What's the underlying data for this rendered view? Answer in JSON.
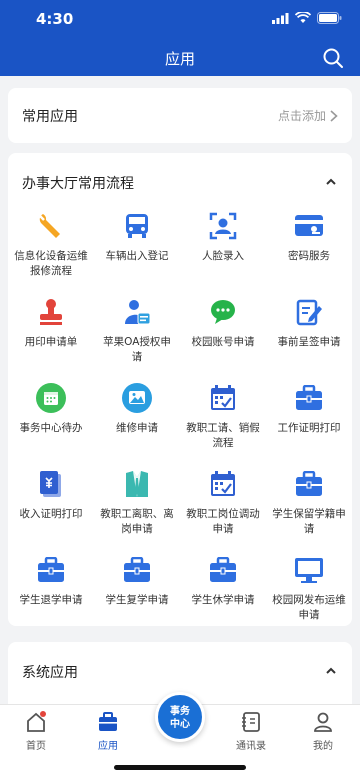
{
  "status": {
    "time": "4:30"
  },
  "header": {
    "title": "应用"
  },
  "common": {
    "label": "常用应用",
    "add_label": "点击添加"
  },
  "hall": {
    "title": "办事大厅常用流程",
    "items": [
      {
        "label": "信息化设备运维报修流程",
        "icon": "wrench-icon",
        "color": "#f5a623"
      },
      {
        "label": "车辆出入登记",
        "icon": "car-icon",
        "color": "#2f6fe0"
      },
      {
        "label": "人脸录入",
        "icon": "face-scan-icon",
        "color": "#2f6fe0"
      },
      {
        "label": "密码服务",
        "icon": "card-icon",
        "color": "#2f6fe0"
      },
      {
        "label": "用印申请单",
        "icon": "stamp-icon",
        "color": "#e2443b"
      },
      {
        "label": "苹果OA授权申请",
        "icon": "user-card-icon",
        "color": "#2f6fe0"
      },
      {
        "label": "校园账号申请",
        "icon": "chat-icon",
        "color": "#26b34a"
      },
      {
        "label": "事前呈签申请",
        "icon": "edit-doc-icon",
        "color": "#2f6fe0"
      },
      {
        "label": "事务中心待办",
        "icon": "calendar-icon",
        "color": "#3cbf5a"
      },
      {
        "label": "维修申请",
        "icon": "image-icon",
        "color": "#2a9ee0"
      },
      {
        "label": "教职工请、销假流程",
        "icon": "calendar-check-icon",
        "color": "#2f5fd0"
      },
      {
        "label": "工作证明打印",
        "icon": "briefcase-icon",
        "color": "#2f6fe0"
      },
      {
        "label": "收入证明打印",
        "icon": "document-icon",
        "color": "#2f5fd0"
      },
      {
        "label": "教职工离职、离岗申请",
        "icon": "shirt-icon",
        "color": "#3bb8b0"
      },
      {
        "label": "教职工岗位调动申请",
        "icon": "calendar-check-icon",
        "color": "#2f5fd0"
      },
      {
        "label": "学生保留学籍申请",
        "icon": "briefcase-icon",
        "color": "#2f6fe0"
      },
      {
        "label": "学生退学申请",
        "icon": "briefcase-icon",
        "color": "#2f6fe0"
      },
      {
        "label": "学生复学申请",
        "icon": "briefcase-icon",
        "color": "#2f6fe0"
      },
      {
        "label": "学生休学申请",
        "icon": "briefcase-icon",
        "color": "#2f6fe0"
      },
      {
        "label": "校园网发布运维申请",
        "icon": "monitor-icon",
        "color": "#2f6fe0"
      }
    ]
  },
  "system": {
    "title": "系统应用"
  },
  "tabs": [
    {
      "label": "首页",
      "icon": "home-icon"
    },
    {
      "label": "应用",
      "icon": "briefcase-icon"
    },
    {
      "label": "通讯录",
      "icon": "contacts-icon"
    },
    {
      "label": "我的",
      "icon": "person-icon"
    }
  ],
  "center": {
    "line1": "事务",
    "line2": "中心"
  },
  "colors": {
    "primary": "#1a54c5",
    "active_tab": "#1a54c5"
  }
}
